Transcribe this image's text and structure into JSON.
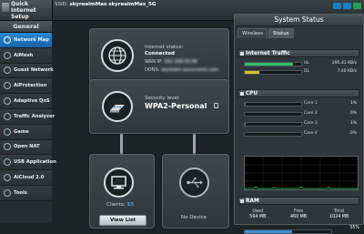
{
  "topbar": {
    "qis_label": "Quick Internet Setup",
    "ssid_label": "SSID:",
    "ssid_2g": "skyrealmMax",
    "ssid_5g": "skyrealmMax_5G"
  },
  "sidebar": {
    "header": "General",
    "items": [
      {
        "label": "Network Map",
        "icon": "network-map-icon"
      },
      {
        "label": "AiMesh",
        "icon": "aimesh-icon"
      },
      {
        "label": "Guest Network",
        "icon": "guest-network-icon"
      },
      {
        "label": "AiProtection",
        "icon": "shield-icon"
      },
      {
        "label": "Adaptive QoS",
        "icon": "qos-icon"
      },
      {
        "label": "Traffic Analyzer",
        "icon": "traffic-analyzer-icon"
      },
      {
        "label": "Game",
        "icon": "game-icon"
      },
      {
        "label": "Open NAT",
        "icon": "open-nat-icon"
      },
      {
        "label": "USB Application",
        "icon": "usb-icon"
      },
      {
        "label": "AiCloud 2.0",
        "icon": "cloud-icon"
      },
      {
        "label": "Tools",
        "icon": "tools-icon"
      }
    ]
  },
  "map": {
    "internet": {
      "status_label": "Internet status:",
      "status_value": "Connected",
      "wan_label": "WAN IP:",
      "wan_value": "192.168.50.98",
      "ddns_label": "DDNS:",
      "ddns_value": "skyrealm.asuscomm.com"
    },
    "router": {
      "security_label": "Security level:",
      "security_value": "WPA2-Personal"
    },
    "clients": {
      "label": "Clients:",
      "count": "15",
      "button": "View List"
    },
    "usb": {
      "label": "No Device"
    }
  },
  "status_panel": {
    "title": "System Status",
    "tabs": [
      "Wireless",
      "Status"
    ],
    "active_tab": "Status",
    "internet_traffic": {
      "title": "Internet Traffic",
      "rows": [
        {
          "tag": "UL",
          "value": "295.41 KB/s",
          "fraction": 0.85
        },
        {
          "tag": "DL",
          "value": "7.40 KB/s",
          "fraction": 0.25
        }
      ]
    },
    "cpu": {
      "title": "CPU",
      "cores": [
        {
          "name": "Core 1",
          "value": "1%",
          "fraction": 0.01
        },
        {
          "name": "Core 2",
          "value": "0%",
          "fraction": 0.0
        },
        {
          "name": "Core 3",
          "value": "1%",
          "fraction": 0.01
        },
        {
          "name": "Core 4",
          "value": "0%",
          "fraction": 0.0
        }
      ]
    },
    "ram": {
      "title": "RAM",
      "used_label": "Used",
      "used_value": "564 MB",
      "free_label": "Free",
      "free_value": "460 MB",
      "total_label": "Total",
      "total_value": "1024 MB",
      "percent": "55%",
      "fraction": 0.55
    }
  },
  "colors": {
    "accent": "#1f73b7",
    "traffic_ul": "#2ec06b",
    "traffic_dl": "#d8be2a",
    "cpu_bar": "#6b767c",
    "ram_bar": "#3a8fd8"
  }
}
